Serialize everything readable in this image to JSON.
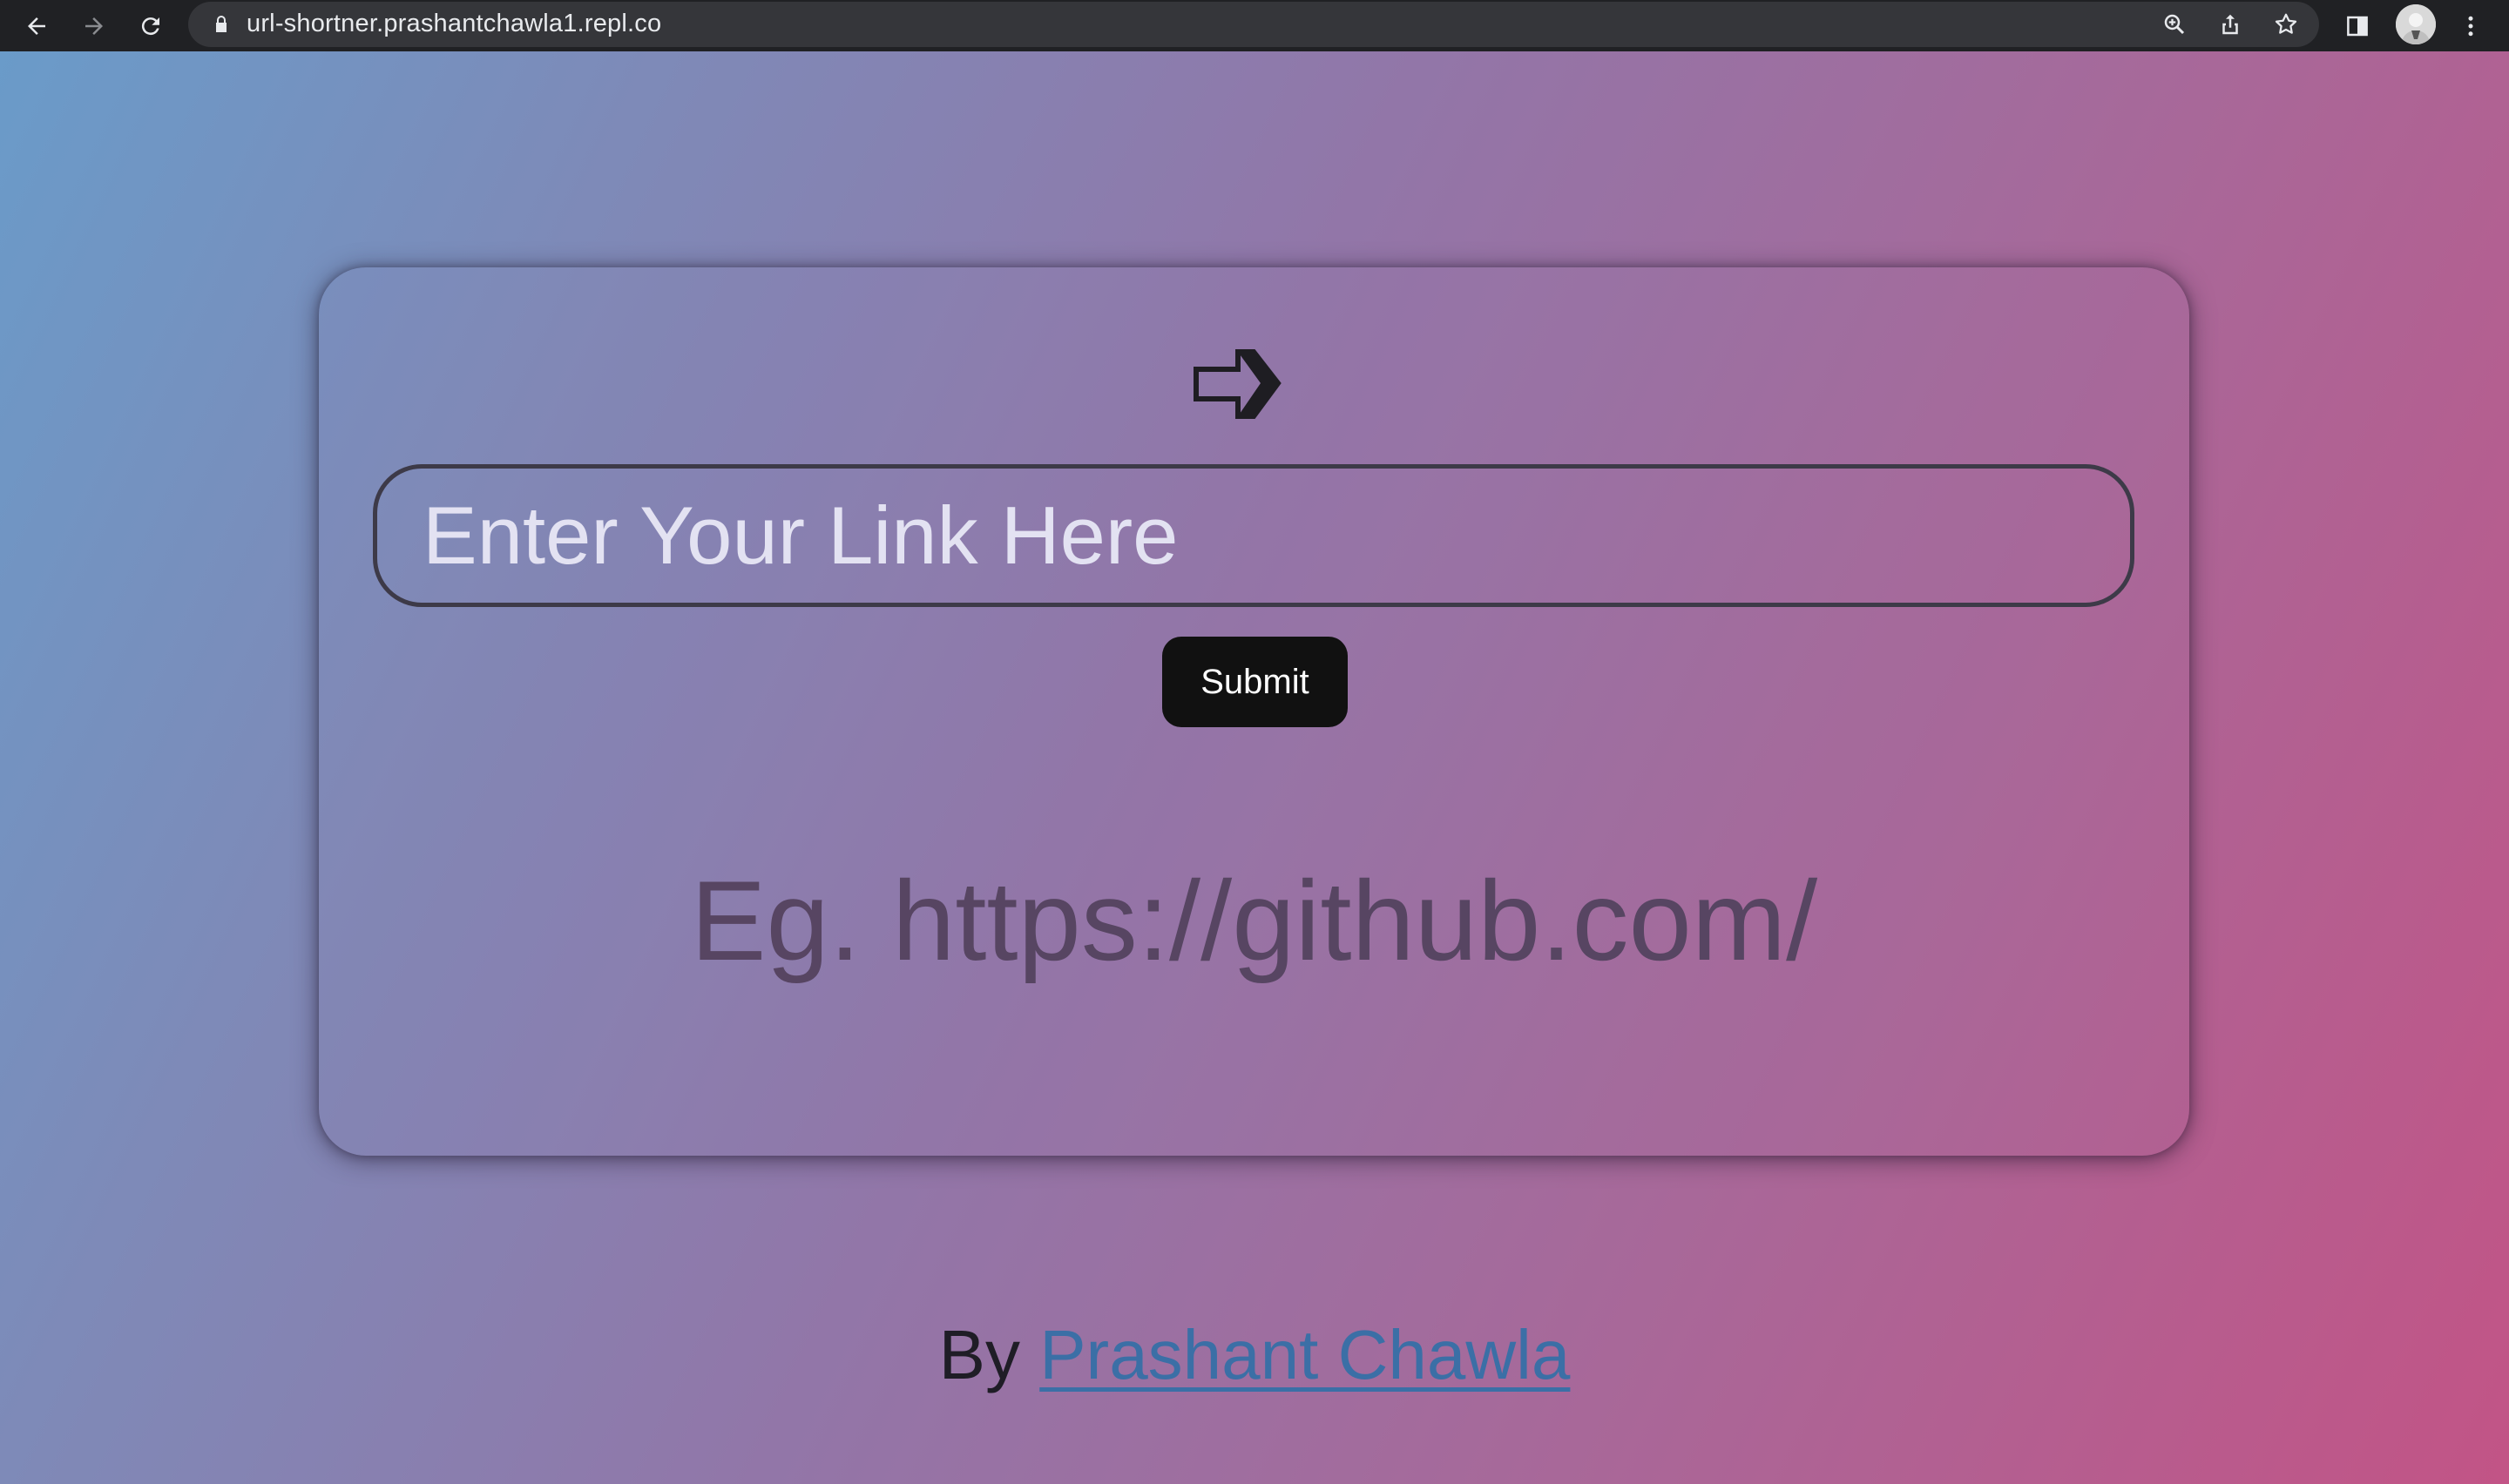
{
  "browser": {
    "url": "url-shortner.prashantchawla1.repl.co",
    "icons": [
      "back-icon",
      "forward-icon",
      "reload-icon",
      "lock-icon",
      "zoom-icon",
      "share-icon",
      "bookmark-star-icon",
      "side-panel-icon",
      "avatar",
      "more-menu-icon"
    ]
  },
  "page": {
    "background_colors": [
      "#6a9bc9",
      "#9276a8",
      "#c25486"
    ],
    "input": {
      "placeholder": "Enter Your Link Here",
      "value": ""
    },
    "submit_label": "Submit",
    "example": "Eg. https://github.com/",
    "footer": {
      "prefix": "By",
      "link_text": "Prashant Chawla"
    }
  }
}
